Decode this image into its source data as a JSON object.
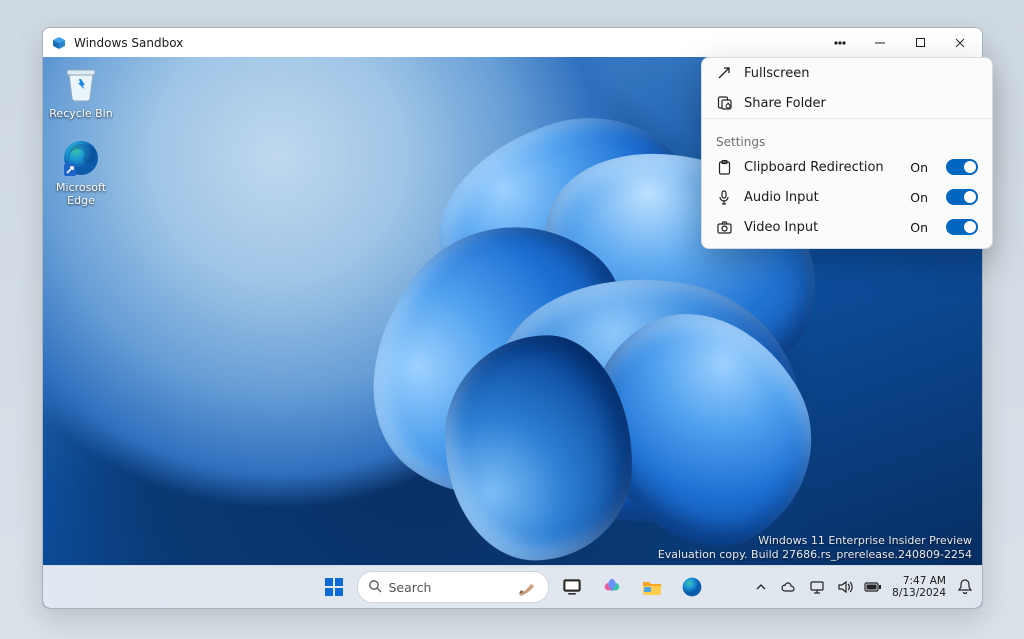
{
  "window": {
    "title": "Windows Sandbox"
  },
  "desktop_icons": [
    {
      "id": "recycle-bin",
      "label": "Recycle Bin"
    },
    {
      "id": "edge",
      "label": "Microsoft Edge"
    }
  ],
  "taskbar": {
    "search_placeholder": "Search"
  },
  "systray": {
    "time": "7:47 AM",
    "date": "8/13/2024"
  },
  "watermark": {
    "line1": "Windows 11 Enterprise Insider Preview",
    "line2": "Evaluation copy. Build 27686.rs_prerelease.240809-2254"
  },
  "flyout": {
    "fullscreen": "Fullscreen",
    "share_folder": "Share Folder",
    "section": "Settings",
    "items": [
      {
        "label": "Clipboard Redirection",
        "state": "On"
      },
      {
        "label": "Audio Input",
        "state": "On"
      },
      {
        "label": "Video Input",
        "state": "On"
      }
    ]
  }
}
